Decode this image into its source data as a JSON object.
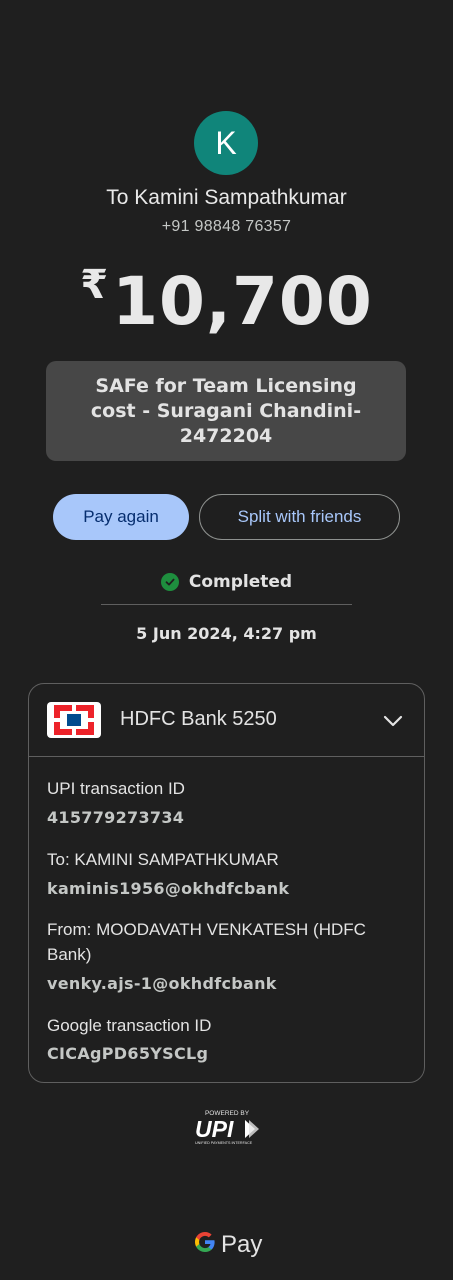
{
  "avatar": {
    "initial": "K",
    "color": "#10857a"
  },
  "recipient": {
    "name": "To Kamini Sampathkumar",
    "phone": "+91 98848 76357"
  },
  "amount": {
    "currency": "₹",
    "value": "10,700"
  },
  "note": "SAFe for Team Licensing cost - Suragani Chandini-2472204",
  "actions": {
    "pay_again": "Pay again",
    "split": "Split with friends"
  },
  "status": {
    "icon": "check-circle-icon",
    "label": "Completed",
    "color": "#1e8e3e"
  },
  "datetime": "5 Jun 2024, 4:27 pm",
  "bank": {
    "logo": "hdfc-logo-icon",
    "name": "HDFC Bank 5250",
    "expand_icon": "chevron-down-icon"
  },
  "details": {
    "upi_label": "UPI transaction ID",
    "upi_value": "415779273734",
    "to_label": "To: KAMINI SAMPATHKUMAR",
    "to_value": "kaminis1956@okhdfcbank",
    "from_label_1": "From: MOODAVATH VENKATESH (HDFC",
    "from_label_2": "Bank)",
    "from_value": "venky.ajs-1@okhdfcbank",
    "google_label": "Google transaction ID",
    "google_value": "CICAgPD65YSCLg"
  },
  "footer": {
    "powered_by": "POWERED BY",
    "upi_text": "UPI",
    "upi_sub": "UNIFIED PAYMENTS INTERFACE",
    "gpay_label": "Pay"
  }
}
